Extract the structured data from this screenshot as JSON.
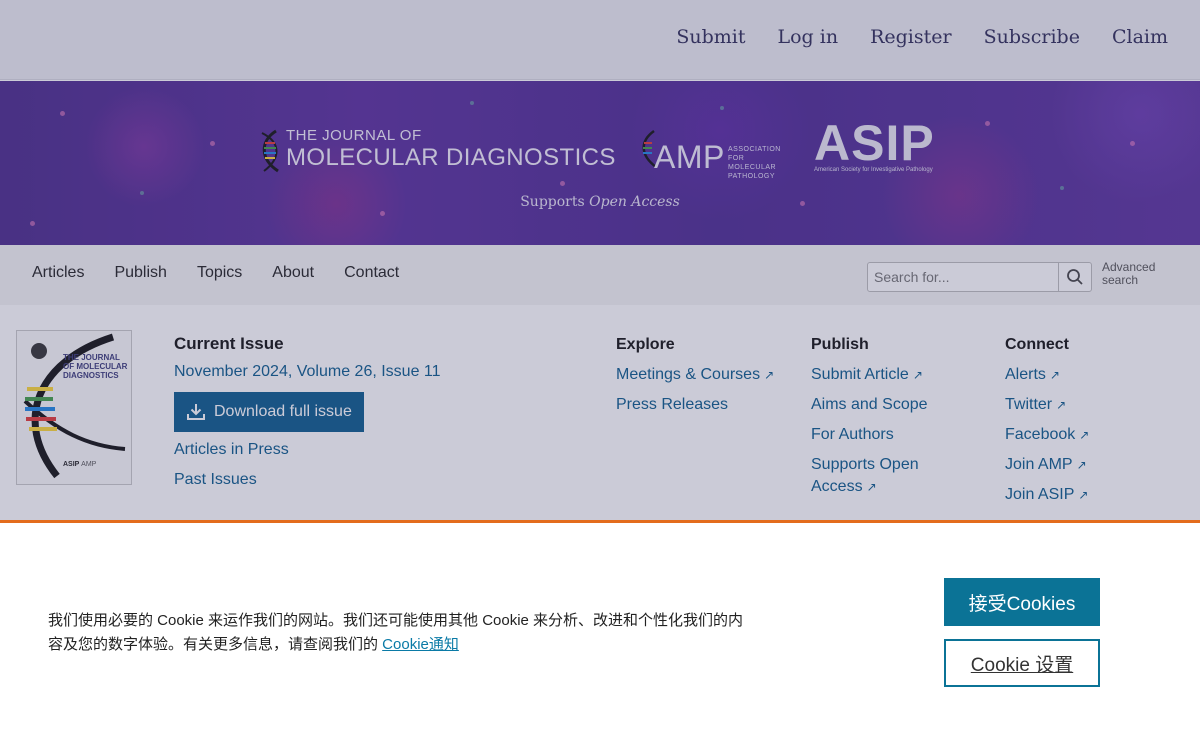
{
  "topbar": {
    "links": [
      "Submit",
      "Log in",
      "Register",
      "Subscribe",
      "Claim"
    ]
  },
  "banner": {
    "journal_line1": "THE JOURNAL OF",
    "journal_line2": "MOLECULAR DIAGNOSTICS",
    "amp_word": "AMP",
    "amp_sub": "Association for Molecular Pathology",
    "asip_word": "ASIP",
    "asip_sub": "American Society for Investigative Pathology",
    "supports_prefix": "Supports ",
    "supports_emph": "Open Access"
  },
  "nav": {
    "items": [
      "Articles",
      "Publish",
      "Topics",
      "About",
      "Contact"
    ],
    "search_placeholder": "Search for...",
    "advanced_search": "Advanced search"
  },
  "issue": {
    "cover_title": "THE JOURNAL OF MOLECULAR DIAGNOSTICS",
    "cover_footer": "ASIP",
    "cover_amp": "AMP",
    "title": "Current Issue",
    "date": "November 2024, Volume 26, Issue 11",
    "download_label": "Download full issue",
    "articles_in_press": "Articles in Press",
    "past_issues": "Past Issues"
  },
  "columns": {
    "explore": {
      "head": "Explore",
      "items": [
        "Meetings & Courses",
        "Press Releases"
      ]
    },
    "publish": {
      "head": "Publish",
      "items": [
        "Submit Article",
        "Aims and Scope",
        "For Authors",
        "Supports Open Access"
      ]
    },
    "connect": {
      "head": "Connect",
      "items": [
        "Alerts",
        "Twitter",
        "Facebook",
        "Join AMP",
        "Join ASIP"
      ]
    }
  },
  "cookie": {
    "message": "我们使用必要的 Cookie 来运作我们的网站。我们还可能使用其他 Cookie 来分析、改进和个性化我们的内容及您的数字体验。有关更多信息，请查阅我们的 ",
    "notice_link": "Cookie通知",
    "accept_label": "接受Cookies",
    "settings_label": "Cookie 设置"
  },
  "colors": {
    "link": "#0b5b8c",
    "accent_orange": "#e36c1c",
    "cookie_button": "#0b7396",
    "banner_purple": "#4b2a8c"
  }
}
